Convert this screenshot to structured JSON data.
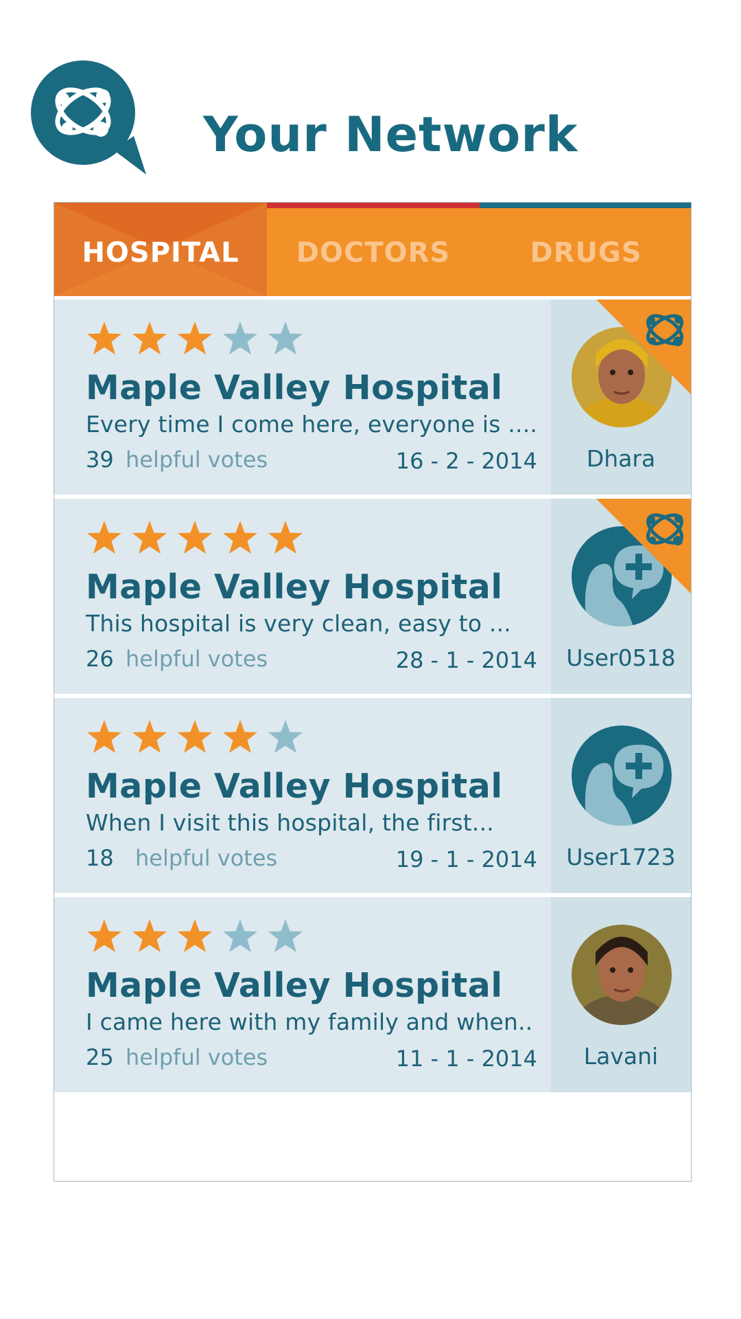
{
  "header": {
    "title": "Your Network",
    "logo_icon": "network-chat-bubble-icon"
  },
  "tabs": [
    {
      "label": "HOSPITAL",
      "active": true
    },
    {
      "label": "DOCTORS",
      "active": false
    },
    {
      "label": "DRUGS",
      "active": false
    }
  ],
  "colors": {
    "brand_teal": "#1a6a80",
    "tab_orange": "#f29127",
    "tab_active": "#e4782a",
    "star_filled": "#f29127",
    "star_empty": "#8fbccb",
    "row_bg": "#dde9ee",
    "stripe_red": "#cf3034",
    "stripe_teal": "#1d6d85"
  },
  "reviews": [
    {
      "rating": 3,
      "hospital": "Maple Valley Hospital",
      "snippet": "Every time I come here, everyone is ....",
      "votes_count": "39",
      "votes_label": "helpful votes",
      "date": "16  - 2 - 2014",
      "username": "Dhara",
      "avatar": "photo",
      "network_badge": true
    },
    {
      "rating": 5,
      "hospital": "Maple Valley Hospital",
      "snippet": "This hospital is very clean, easy to ...",
      "votes_count": "26",
      "votes_label": "helpful votes",
      "date": "28 - 1 - 2014",
      "username": "User0518",
      "avatar": "default-user",
      "network_badge": true
    },
    {
      "rating": 4,
      "hospital": "Maple Valley Hospital",
      "snippet": "When I visit this hospital, the first...",
      "votes_count": "18",
      "votes_label": "helpful votes",
      "date": "19 - 1 - 2014",
      "username": "User1723",
      "avatar": "default-user",
      "network_badge": false
    },
    {
      "rating": 3,
      "hospital": "Maple Valley Hospital",
      "snippet": "I came here with my family and when..",
      "votes_count": "25",
      "votes_label": "helpful votes",
      "date": "11 - 1 - 2014",
      "username": "Lavani",
      "avatar": "photo",
      "network_badge": false
    }
  ]
}
